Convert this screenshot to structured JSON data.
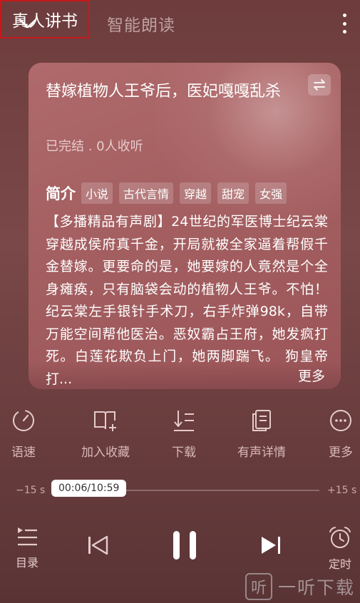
{
  "header": {
    "tabs": [
      {
        "label": "智能朗读",
        "active": false
      },
      {
        "label": "真人讲书",
        "active": true
      }
    ]
  },
  "book": {
    "title": "替嫁植物人王爷后，医妃嘎嘎乱杀",
    "meta": "已完结 . 0人收听",
    "intro_label": "简介",
    "tags": [
      "小说",
      "古代言情",
      "穿越",
      "甜宠",
      "女强"
    ],
    "description": "【多播精品有声剧】24世纪的军医博士纪云棠穿越成侯府真千金，开局就被全家逼着帮假千金替嫁。更要命的是，她要嫁的人竟然是个全身瘫痪，只有脑袋会动的植物人王爷。不怕！ 纪云棠左手银针手术刀，右手炸弹98k，自带万能空间帮他医治。恶奴霸占王府，她发疯打死。白莲花欺负上门，她两脚踹飞。 狗皇帝打...",
    "more_label": "更多"
  },
  "actions": [
    {
      "label": "语速",
      "icon": "speed-icon"
    },
    {
      "label": "加入收藏",
      "icon": "add-bookmark-icon"
    },
    {
      "label": "下载",
      "icon": "download-icon"
    },
    {
      "label": "有声详情",
      "icon": "detail-icon"
    },
    {
      "label": "更多",
      "icon": "more-circle-icon"
    }
  ],
  "player": {
    "seek_back": "−15 s",
    "seek_forward": "+15 s",
    "time": "00:06/10:59",
    "progress_fraction": 0.009
  },
  "controls": {
    "catalog_label": "目录",
    "timer_label": "定时"
  },
  "watermark": {
    "box": "听",
    "text": "一听下载"
  },
  "colors": {
    "active_tab_border": "#c51a1a",
    "background": "#7a4848",
    "card": "#a66163"
  }
}
